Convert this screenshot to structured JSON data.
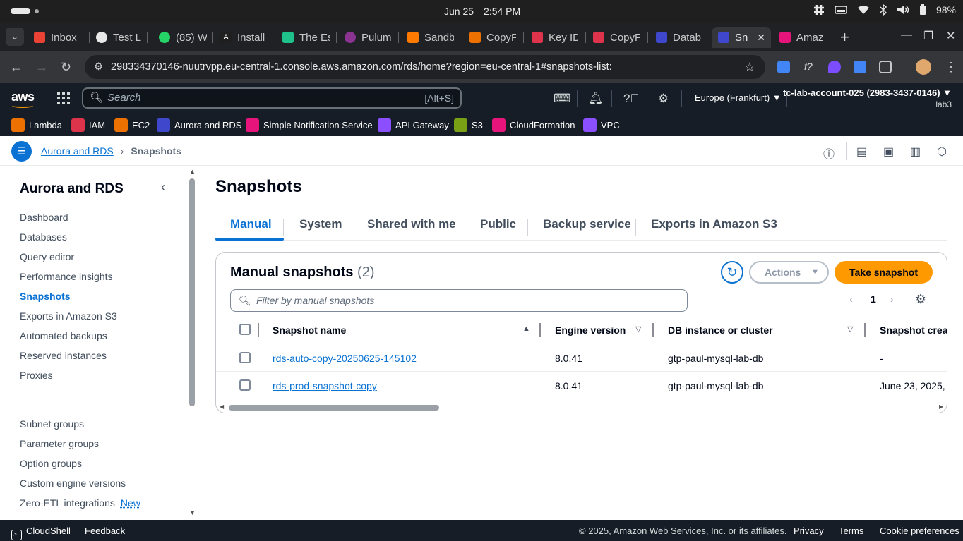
{
  "os": {
    "date": "Jun 25",
    "time": "2:54 PM",
    "battery": "98%"
  },
  "browser": {
    "tabs": [
      {
        "label": "Inbox",
        "color": "#ea4335"
      },
      {
        "label": "Test L",
        "color": "#e8e8e8"
      },
      {
        "label": "(85) W",
        "color": "#25d366"
      },
      {
        "label": "Install",
        "color": "#1f1f1f"
      },
      {
        "label": "The Es",
        "color": "#1fc18b"
      },
      {
        "label": "Pulum",
        "color": "#8a3391"
      },
      {
        "label": "Sandb",
        "color": "#ff7a00"
      },
      {
        "label": "CopyF",
        "color": "#ed7100"
      },
      {
        "label": "Key ID",
        "color": "#dd344c"
      },
      {
        "label": "CopyF",
        "color": "#dd344c"
      },
      {
        "label": "Datab",
        "color": "#3f48cc"
      },
      {
        "label": "Sn",
        "color": "#3f48cc"
      },
      {
        "label": "Amaz",
        "color": "#e7157b"
      }
    ],
    "new_tab": "+",
    "url": "298334370146-nuutrvpp.eu-central-1.console.aws.amazon.com/rds/home?region=eu-central-1#snapshots-list:"
  },
  "aws_header": {
    "logo": "aws",
    "search_placeholder": "Search",
    "search_shortcut": "[Alt+S]",
    "region": "Europe (Frankfurt) ▼",
    "account": "tc-lab-account-025 (2983-3437-0146) ▼",
    "account_sub": "lab3"
  },
  "favorites": [
    {
      "label": "Lambda",
      "color": "#ed7100"
    },
    {
      "label": "IAM",
      "color": "#dd344c"
    },
    {
      "label": "EC2",
      "color": "#ed7100"
    },
    {
      "label": "Aurora and RDS",
      "color": "#3f48cc"
    },
    {
      "label": "Simple Notification Service",
      "color": "#e7157b"
    },
    {
      "label": "API Gateway",
      "color": "#8c4fff"
    },
    {
      "label": "S3",
      "color": "#7aa116"
    },
    {
      "label": "CloudFormation",
      "color": "#e7157b"
    },
    {
      "label": "VPC",
      "color": "#8c4fff"
    }
  ],
  "breadcrumb": {
    "root": "Aurora and RDS",
    "current": "Snapshots"
  },
  "sidenav": {
    "title": "Aurora and RDS",
    "items": [
      "Dashboard",
      "Databases",
      "Query editor",
      "Performance insights",
      "Snapshots",
      "Exports in Amazon S3",
      "Automated backups",
      "Reserved instances",
      "Proxies"
    ],
    "items2": [
      "Subnet groups",
      "Parameter groups",
      "Option groups",
      "Custom engine versions",
      "Zero-ETL integrations"
    ],
    "new_badge": "New"
  },
  "page": {
    "title": "Snapshots",
    "tabs": [
      "Manual",
      "System",
      "Shared with me",
      "Public",
      "Backup service",
      "Exports in Amazon S3"
    ]
  },
  "card": {
    "title": "Manual snapshots",
    "count": "(2)",
    "actions_label": "Actions",
    "take_snapshot_label": "Take snapshot",
    "filter_placeholder": "Filter by manual snapshots",
    "page_number": "1",
    "columns": [
      "Snapshot name",
      "Engine version",
      "DB instance or cluster",
      "Snapshot creat"
    ],
    "rows": [
      {
        "name": "rds-auto-copy-20250625-145102",
        "engine": "8.0.41",
        "instance": "gtp-paul-mysql-lab-db",
        "created": "-"
      },
      {
        "name": "rds-prod-snapshot-copy",
        "engine": "8.0.41",
        "instance": "gtp-paul-mysql-lab-db",
        "created": "June 23, 2025,"
      }
    ]
  },
  "footer": {
    "cloudshell": "CloudShell",
    "feedback": "Feedback",
    "copyright": "© 2025, Amazon Web Services, Inc. or its affiliates.",
    "privacy": "Privacy",
    "terms": "Terms",
    "cookies": "Cookie preferences"
  },
  "colors": {
    "accent": "#0972d3",
    "primary_button": "#ff9900",
    "header_bg": "#161d26"
  }
}
